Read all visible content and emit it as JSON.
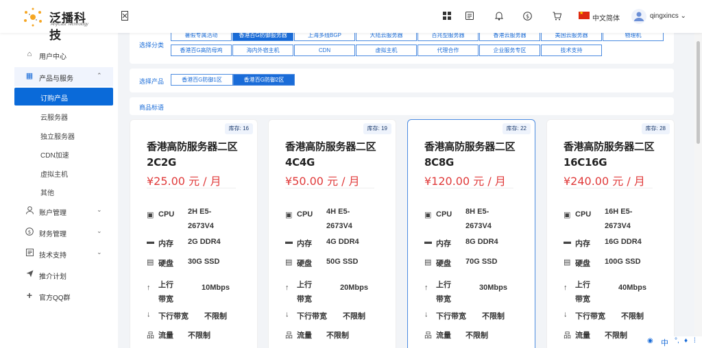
{
  "header": {
    "logo_text": "泛播科技",
    "logo_sub": "AnyCast Technology",
    "language": "中文简体",
    "user_name": "qingxincs",
    "icons": [
      "grid-icon",
      "document-icon",
      "bell-icon",
      "dollar-icon",
      "cart-icon"
    ]
  },
  "sidebar": {
    "items": [
      {
        "label": "用户中心",
        "icon": "home-icon"
      },
      {
        "label": "产品与服务",
        "icon": "grid-icon"
      },
      {
        "label": "订购产品"
      },
      {
        "label": "云服务器"
      },
      {
        "label": "独立服务器"
      },
      {
        "label": "CDN加速"
      },
      {
        "label": "虚拟主机"
      },
      {
        "label": "其他"
      },
      {
        "label": "账户管理",
        "icon": "user-icon"
      },
      {
        "label": "财务管理",
        "icon": "dollar-icon"
      },
      {
        "label": "技术支持",
        "icon": "list-icon"
      },
      {
        "label": "推介计划",
        "icon": "send-icon"
      },
      {
        "label": "官方QQ群",
        "icon": "plus-icon"
      }
    ]
  },
  "category": {
    "label": "选择分类",
    "row1": [
      "暑假专属活动",
      "香港百G防御服务器",
      "上海多线BGP",
      "大陆云服务器",
      "百兆型服务器",
      "香港云服务器",
      "美国云服务器",
      "物理机"
    ],
    "row2": [
      "香港百G高防母鸡",
      "海内外宿主机",
      "CDN",
      "虚拟主机",
      "代理合作",
      "企业服务专区",
      "技术支持"
    ]
  },
  "product": {
    "label": "选择产品",
    "options": [
      "香港百G防御1区",
      "香港百G防御2区"
    ]
  },
  "tags": {
    "label": "商品标语"
  },
  "cards": [
    {
      "stock": "库存: 16",
      "title": "香港高防服务器二区 2C2G",
      "price": "¥25.00 元 / 月",
      "cpu_label": "CPU",
      "cpu": "2H E5-2673V4",
      "mem_label": "内存",
      "mem": "2G DDR4",
      "disk_label": "硬盘",
      "disk": "30G SSD",
      "up_label": "上行带宽",
      "up": "10Mbps",
      "down_label": "下行带宽",
      "down": "不限制",
      "traffic_label": "流量",
      "traffic": "不限制"
    },
    {
      "stock": "库存: 19",
      "title": "香港高防服务器二区 4C4G",
      "price": "¥50.00 元 / 月",
      "cpu_label": "CPU",
      "cpu": "4H E5-2673V4",
      "mem_label": "内存",
      "mem": "4G DDR4",
      "disk_label": "硬盘",
      "disk": "50G SSD",
      "up_label": "上行带宽",
      "up": "20Mbps",
      "down_label": "下行带宽",
      "down": "不限制",
      "traffic_label": "流量",
      "traffic": "不限制"
    },
    {
      "stock": "库存: 22",
      "title": "香港高防服务器二区 8C8G",
      "price": "¥120.00 元 / 月",
      "cpu_label": "CPU",
      "cpu": "8H E5-2673V4",
      "mem_label": "内存",
      "mem": "8G DDR4",
      "disk_label": "硬盘",
      "disk": "70G SSD",
      "up_label": "上行带宽",
      "up": "30Mbps",
      "down_label": "下行带宽",
      "down": "不限制",
      "traffic_label": "流量",
      "traffic": "不限制"
    },
    {
      "stock": "库存: 28",
      "title": "香港高防服务器二区 16C16G",
      "price": "¥240.00 元 / 月",
      "cpu_label": "CPU",
      "cpu": "16H E5-2673V4",
      "mem_label": "内存",
      "mem": "16G DDR4",
      "disk_label": "硬盘",
      "disk": "100G SSD",
      "up_label": "上行带宽",
      "up": "40Mbps",
      "down_label": "下行带宽",
      "down": "不限制",
      "traffic_label": "流量",
      "traffic": "不限制"
    }
  ],
  "float_tools": {
    "lang_char": "中"
  },
  "colors": {
    "primary": "#1a6cd8",
    "price": "#e03a3a"
  }
}
